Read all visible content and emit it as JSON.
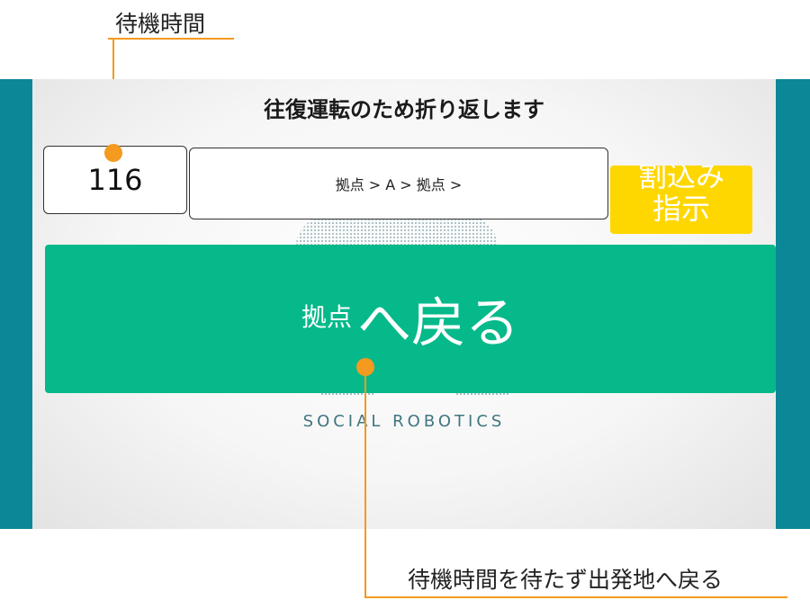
{
  "annotations": {
    "wait_time_label": "待機時間",
    "return_note": "待機時間を待たず出発地へ戻る"
  },
  "screen": {
    "title": "往復運転のため折り返します",
    "wait_time_value": "116",
    "route": "拠点 > A > 拠点 >",
    "interrupt_button_label": "割込み指示",
    "return_button": {
      "destination": "拠点",
      "action": "へ戻る"
    },
    "logo_text": "SOCIAL ROBOTICS"
  },
  "colors": {
    "frame": "#0b8797",
    "return_button": "#05b98a",
    "interrupt_button": "#ffd700",
    "callout": "#f39a1f"
  }
}
